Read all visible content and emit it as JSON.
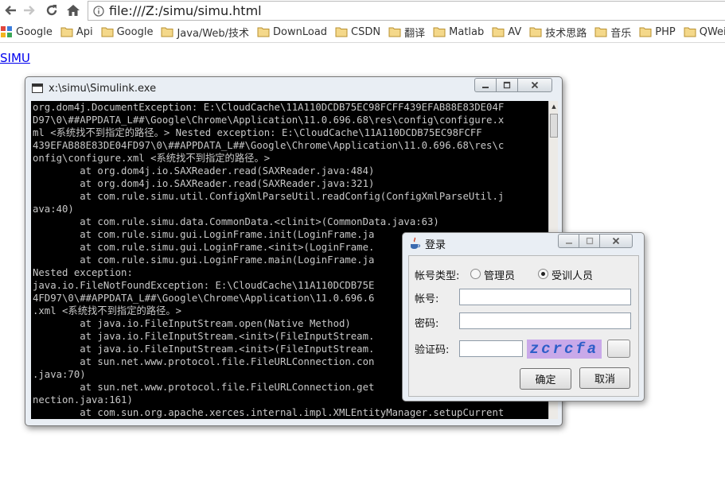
{
  "browser": {
    "url": "file:///Z:/simu/simu.html",
    "bookmarks": [
      {
        "label": "Google",
        "icon": "google-apps-icon"
      },
      {
        "label": "Api",
        "icon": "folder-icon"
      },
      {
        "label": "Google",
        "icon": "folder-icon"
      },
      {
        "label": "Java/Web/技术",
        "icon": "folder-icon"
      },
      {
        "label": "DownLoad",
        "icon": "folder-icon"
      },
      {
        "label": "CSDN",
        "icon": "folder-icon"
      },
      {
        "label": "翻译",
        "icon": "folder-icon"
      },
      {
        "label": "Matlab",
        "icon": "folder-icon"
      },
      {
        "label": "AV",
        "icon": "folder-icon"
      },
      {
        "label": "技术思路",
        "icon": "folder-icon"
      },
      {
        "label": "音乐",
        "icon": "folder-icon"
      },
      {
        "label": "PHP",
        "icon": "folder-icon"
      },
      {
        "label": "QWei",
        "icon": "folder-icon"
      }
    ]
  },
  "page": {
    "link_text": "SIMU"
  },
  "console": {
    "title": "x:\\simu\\Simulink.exe",
    "lines": [
      "org.dom4j.DocumentException: E:\\CloudCache\\11A110DCDB75EC98FCFF439EFAB88E83DE04F",
      "D97\\0\\##APPDATA_L##\\Google\\Chrome\\Application\\11.0.696.68\\res\\config\\configure.x",
      "ml <系统找不到指定的路径。> Nested exception: E:\\CloudCache\\11A110DCDB75EC98FCFF",
      "439EFAB88E83DE04FD97\\0\\##APPDATA_L##\\Google\\Chrome\\Application\\11.0.696.68\\res\\c",
      "onfig\\configure.xml <系统找不到指定的路径。>",
      "        at org.dom4j.io.SAXReader.read(SAXReader.java:484)",
      "        at org.dom4j.io.SAXReader.read(SAXReader.java:321)",
      "        at com.rule.simu.util.ConfigXmlParseUtil.readConfig(ConfigXmlParseUtil.j",
      "ava:40)",
      "        at com.rule.simu.data.CommonData.<clinit>(CommonData.java:63)",
      "        at com.rule.simu.gui.LoginFrame.init(LoginFrame.ja",
      "        at com.rule.simu.gui.LoginFrame.<init>(LoginFrame.",
      "        at com.rule.simu.gui.LoginFrame.main(LoginFrame.ja",
      "Nested exception:",
      "java.io.FileNotFoundException: E:\\CloudCache\\11A110DCDB75E",
      "4FD97\\0\\##APPDATA_L##\\Google\\Chrome\\Application\\11.0.696.6",
      ".xml <系统找不到指定的路径。>",
      "        at java.io.FileInputStream.open(Native Method)",
      "        at java.io.FileInputStream.<init>(FileInputStream.",
      "        at java.io.FileInputStream.<init>(FileInputStream.",
      "        at sun.net.www.protocol.file.FileURLConnection.con",
      ".java:70)",
      "        at sun.net.www.protocol.file.FileURLConnection.get",
      "nection.java:161)",
      "        at com.sun.org.apache.xerces.internal.impl.XMLEntityManager.setupCurrent"
    ]
  },
  "login": {
    "title": "登录",
    "account_type_label": "帐号类型:",
    "radio_admin": "管理员",
    "radio_trainee": "受训人员",
    "selected_type": "受训人员",
    "account_label": "帐号:",
    "password_label": "密码:",
    "captcha_label": "验证码:",
    "captcha_text": "zcrcfa",
    "ok_label": "确定",
    "cancel_label": "取消",
    "colors": {
      "captcha_bg": "#c9a9e9",
      "captcha_fg": "#2d5ec8"
    }
  }
}
